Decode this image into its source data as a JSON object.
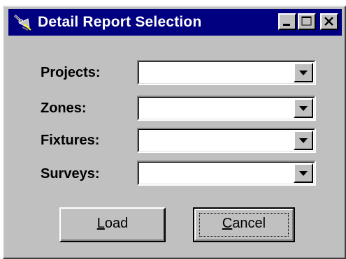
{
  "window": {
    "title": "Detail Report Selection",
    "title_icon": "satellite-dish-icon",
    "titlebar_color": "#000080",
    "controls": [
      "minimize-icon",
      "maximize-icon",
      "close-icon"
    ]
  },
  "form": {
    "projects": {
      "label": "Projects:",
      "value": ""
    },
    "zones": {
      "label": "Zones:",
      "value": ""
    },
    "fixtures": {
      "label": "Fixtures:",
      "value": ""
    },
    "surveys": {
      "label": "Surveys:",
      "value": ""
    }
  },
  "buttons": {
    "load": {
      "mnemonic": "L",
      "rest": "oad"
    },
    "cancel": {
      "mnemonic": "C",
      "rest": "ancel"
    }
  }
}
